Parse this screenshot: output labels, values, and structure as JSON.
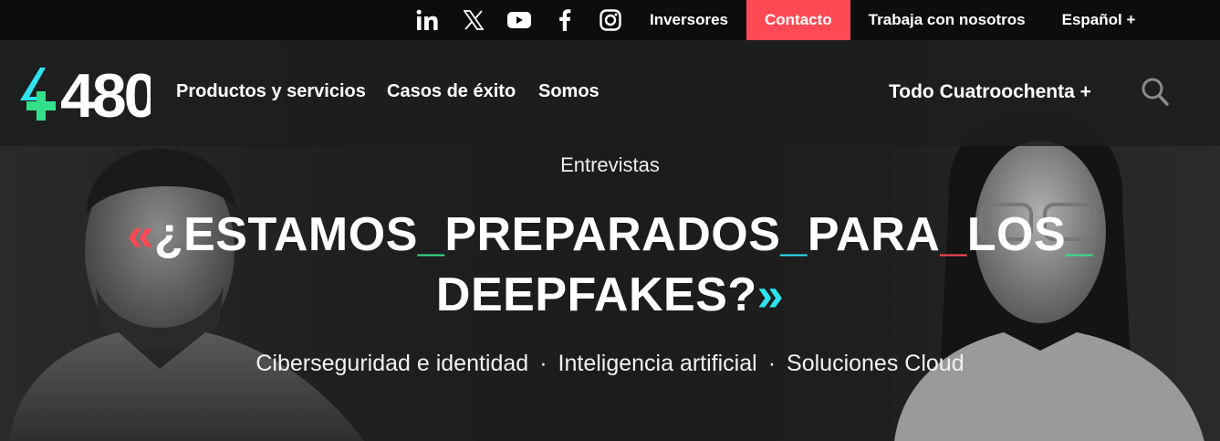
{
  "topbar": {
    "social": [
      "linkedin-icon",
      "x-icon",
      "youtube-icon",
      "facebook-icon",
      "instagram-icon"
    ],
    "links": {
      "investors": "Inversores",
      "contact": "Contacto",
      "work": "Trabaja con nosotros",
      "language": "Español +"
    },
    "colors": {
      "contact_bg": "#ff4a55",
      "bar_bg": "#0d0d0d"
    }
  },
  "nav": {
    "logo_text": "480",
    "items": [
      "Productos y servicios",
      "Casos de éxito",
      "Somos"
    ],
    "all": "Todo Cuatroochenta +"
  },
  "hero": {
    "category": "Entrevistas",
    "title": {
      "open_quote": "«",
      "w1": "¿ESTAMOS",
      "w2": "PREPARADOS",
      "w3": "PARA",
      "w4": "LOS",
      "w5": "DEEPFAKES?",
      "underscore": "_",
      "close_quote": "»"
    },
    "tags": [
      "Ciberseguridad e identidad",
      "Inteligencia artificial",
      "Soluciones Cloud"
    ],
    "separator": "·"
  },
  "accent_colors": {
    "red": "#ff4a55",
    "cyan": "#2de4f0",
    "green": "#35e08c"
  }
}
